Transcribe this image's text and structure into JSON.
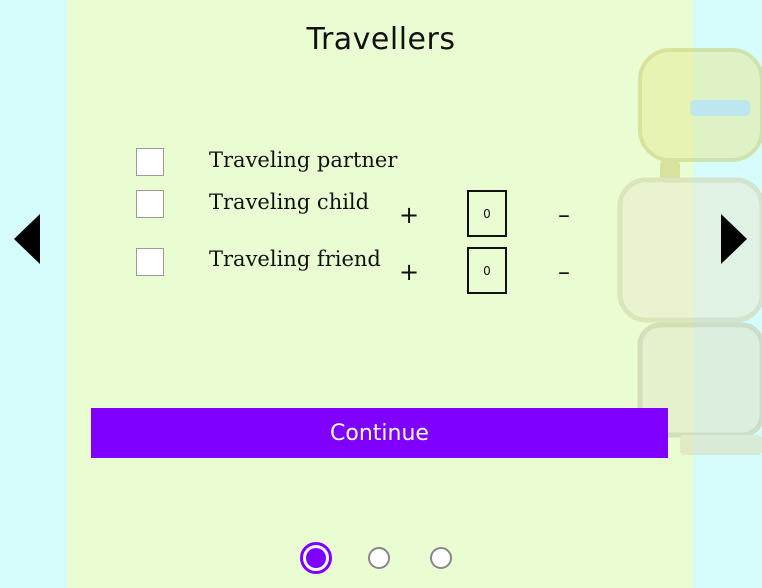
{
  "header": {
    "title": "Travellers"
  },
  "options": [
    {
      "label": "Traveling partner",
      "checked": false
    },
    {
      "label": "Traveling child",
      "checked": false,
      "plus": "+",
      "minus": "–",
      "count": "0"
    },
    {
      "label": "Traveling friend",
      "checked": false,
      "plus": "+",
      "minus": "–",
      "count": "0"
    }
  ],
  "actions": {
    "continue_label": "Continue"
  },
  "pagination": {
    "current": 1,
    "total": 3
  },
  "colors": {
    "accent": "#8000ff",
    "panel": "#eafdd2",
    "background": "#d6fbfb"
  },
  "icons": {
    "prev": "caret-left-icon",
    "next": "caret-right-icon",
    "decoration": "suitcase-stack-illustration"
  }
}
